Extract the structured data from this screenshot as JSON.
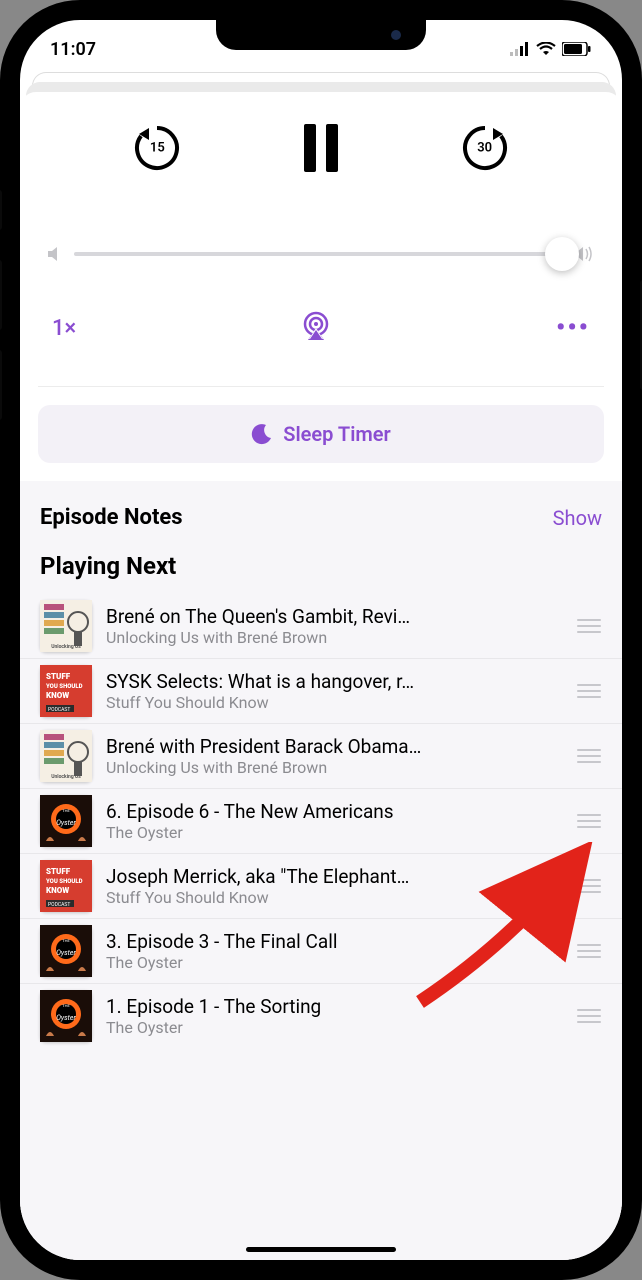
{
  "status": {
    "time": "11:07"
  },
  "playback": {
    "skip_back": "15",
    "skip_forward": "30"
  },
  "secondary": {
    "speed": "1×"
  },
  "sleep_timer": {
    "label": "Sleep Timer"
  },
  "episode_notes": {
    "title": "Episode Notes",
    "show_link": "Show"
  },
  "playing_next": {
    "title": "Playing Next",
    "items": [
      {
        "title": "Brené on The Queen's Gambit, Revi…",
        "subtitle": "Unlocking Us with Brené Brown",
        "art": "unlocking"
      },
      {
        "title": "SYSK Selects: What is a hangover, r…",
        "subtitle": "Stuff You Should Know",
        "art": "sysk"
      },
      {
        "title": "Brené with President Barack Obama…",
        "subtitle": "Unlocking Us with Brené Brown",
        "art": "unlocking"
      },
      {
        "title": "6. Episode 6 - The New Americans",
        "subtitle": "The Oyster",
        "art": "oyster"
      },
      {
        "title": "Joseph Merrick, aka \"The Elephant…",
        "subtitle": "Stuff You Should Know",
        "art": "sysk"
      },
      {
        "title": "3. Episode 3 - The Final Call",
        "subtitle": "The Oyster",
        "art": "oyster"
      },
      {
        "title": "1. Episode 1 - The Sorting",
        "subtitle": "The Oyster",
        "art": "oyster"
      }
    ]
  },
  "colors": {
    "accent": "#8a4dd1"
  }
}
